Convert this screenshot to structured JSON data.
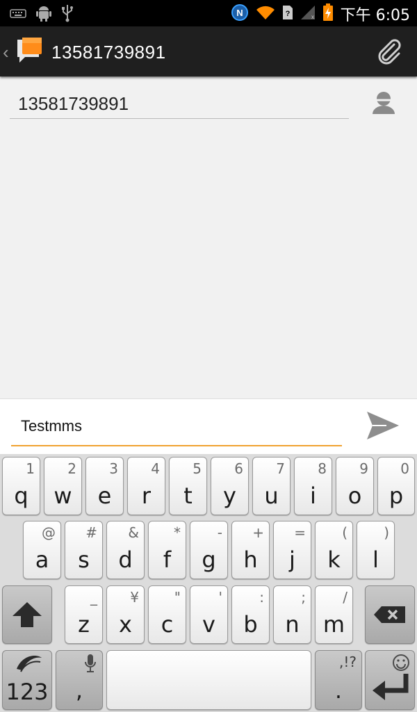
{
  "status_bar": {
    "time": "下午 6:05",
    "icons_left": [
      "keyboard-icon",
      "android-icon",
      "usb-icon"
    ],
    "icons_right": [
      "nfc-icon",
      "wifi-icon",
      "sim-icon",
      "signal-icon",
      "battery-icon"
    ]
  },
  "action_bar": {
    "back_glyph": "‹",
    "title": "13581739891",
    "attach_icon": "paperclip-icon"
  },
  "recipient": {
    "value": "13581739891",
    "contact_icon": "contact-icon"
  },
  "compose": {
    "value": "Testmms",
    "send_icon": "send-icon",
    "accent_color": "#f0a12e"
  },
  "keyboard": {
    "row1": [
      {
        "main": "q",
        "alt": "1"
      },
      {
        "main": "w",
        "alt": "2"
      },
      {
        "main": "e",
        "alt": "3"
      },
      {
        "main": "r",
        "alt": "4"
      },
      {
        "main": "t",
        "alt": "5"
      },
      {
        "main": "y",
        "alt": "6"
      },
      {
        "main": "u",
        "alt": "7"
      },
      {
        "main": "i",
        "alt": "8"
      },
      {
        "main": "o",
        "alt": "9"
      },
      {
        "main": "p",
        "alt": "0"
      }
    ],
    "row2": [
      {
        "main": "a",
        "alt": "@"
      },
      {
        "main": "s",
        "alt": "#"
      },
      {
        "main": "d",
        "alt": "&"
      },
      {
        "main": "f",
        "alt": "*"
      },
      {
        "main": "g",
        "alt": "-"
      },
      {
        "main": "h",
        "alt": "+"
      },
      {
        "main": "j",
        "alt": "="
      },
      {
        "main": "k",
        "alt": "("
      },
      {
        "main": "l",
        "alt": ")"
      }
    ],
    "row3": [
      {
        "main": "z",
        "alt": "_"
      },
      {
        "main": "x",
        "alt": "¥"
      },
      {
        "main": "c",
        "alt": "\""
      },
      {
        "main": "v",
        "alt": "'"
      },
      {
        "main": "b",
        "alt": ":"
      },
      {
        "main": "n",
        "alt": ";"
      },
      {
        "main": "m",
        "alt": "/"
      }
    ],
    "shift_icon": "shift-icon",
    "backspace_icon": "backspace-icon",
    "numbers_label": "123",
    "comma_label": ",",
    "mic_icon": "microphone-icon",
    "period_label": ".",
    "period_alt": ",!?",
    "enter_icon": "enter-icon",
    "smiley_icon": "smiley-icon",
    "swiftkey_icon": "swiftkey-icon"
  }
}
